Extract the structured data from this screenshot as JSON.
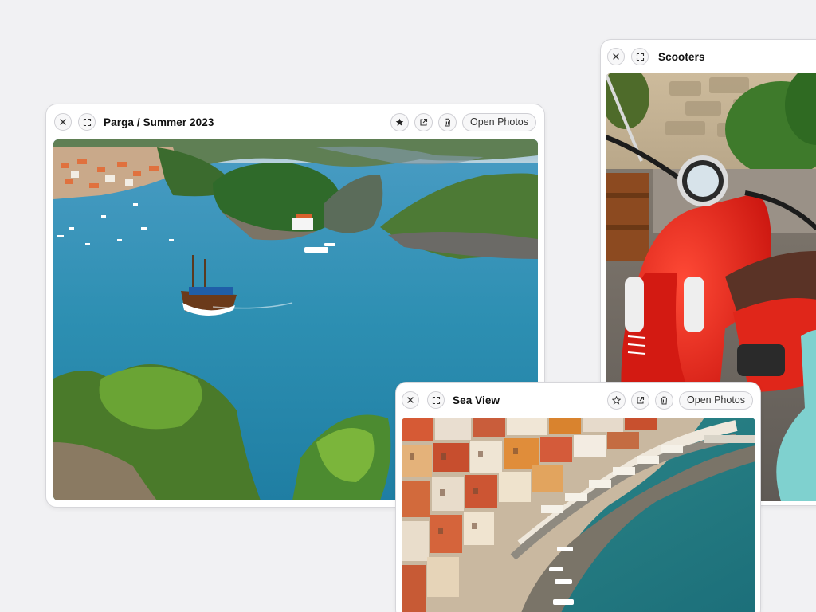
{
  "windows": {
    "scooters": {
      "title": "Scooters",
      "photo_subject": "red-scooter-photo"
    },
    "parga": {
      "title": "Parga / Summer 2023",
      "open_button": "Open Photos",
      "favorited": true,
      "photo_subject": "parga-bay-photo"
    },
    "seaview": {
      "title": "Sea View",
      "open_button": "Open Photos",
      "favorited": false,
      "photo_subject": "harbor-town-photo"
    }
  },
  "icons": {
    "close": "close-icon",
    "expand": "expand-icon",
    "star": "star-icon",
    "share": "share-icon",
    "trash": "trash-icon"
  },
  "colors": {
    "background": "#f1f1f3",
    "window": "#ffffff",
    "border": "#d6d6da",
    "sea": "#2f8fb0",
    "scooter_red": "#e8251c"
  }
}
